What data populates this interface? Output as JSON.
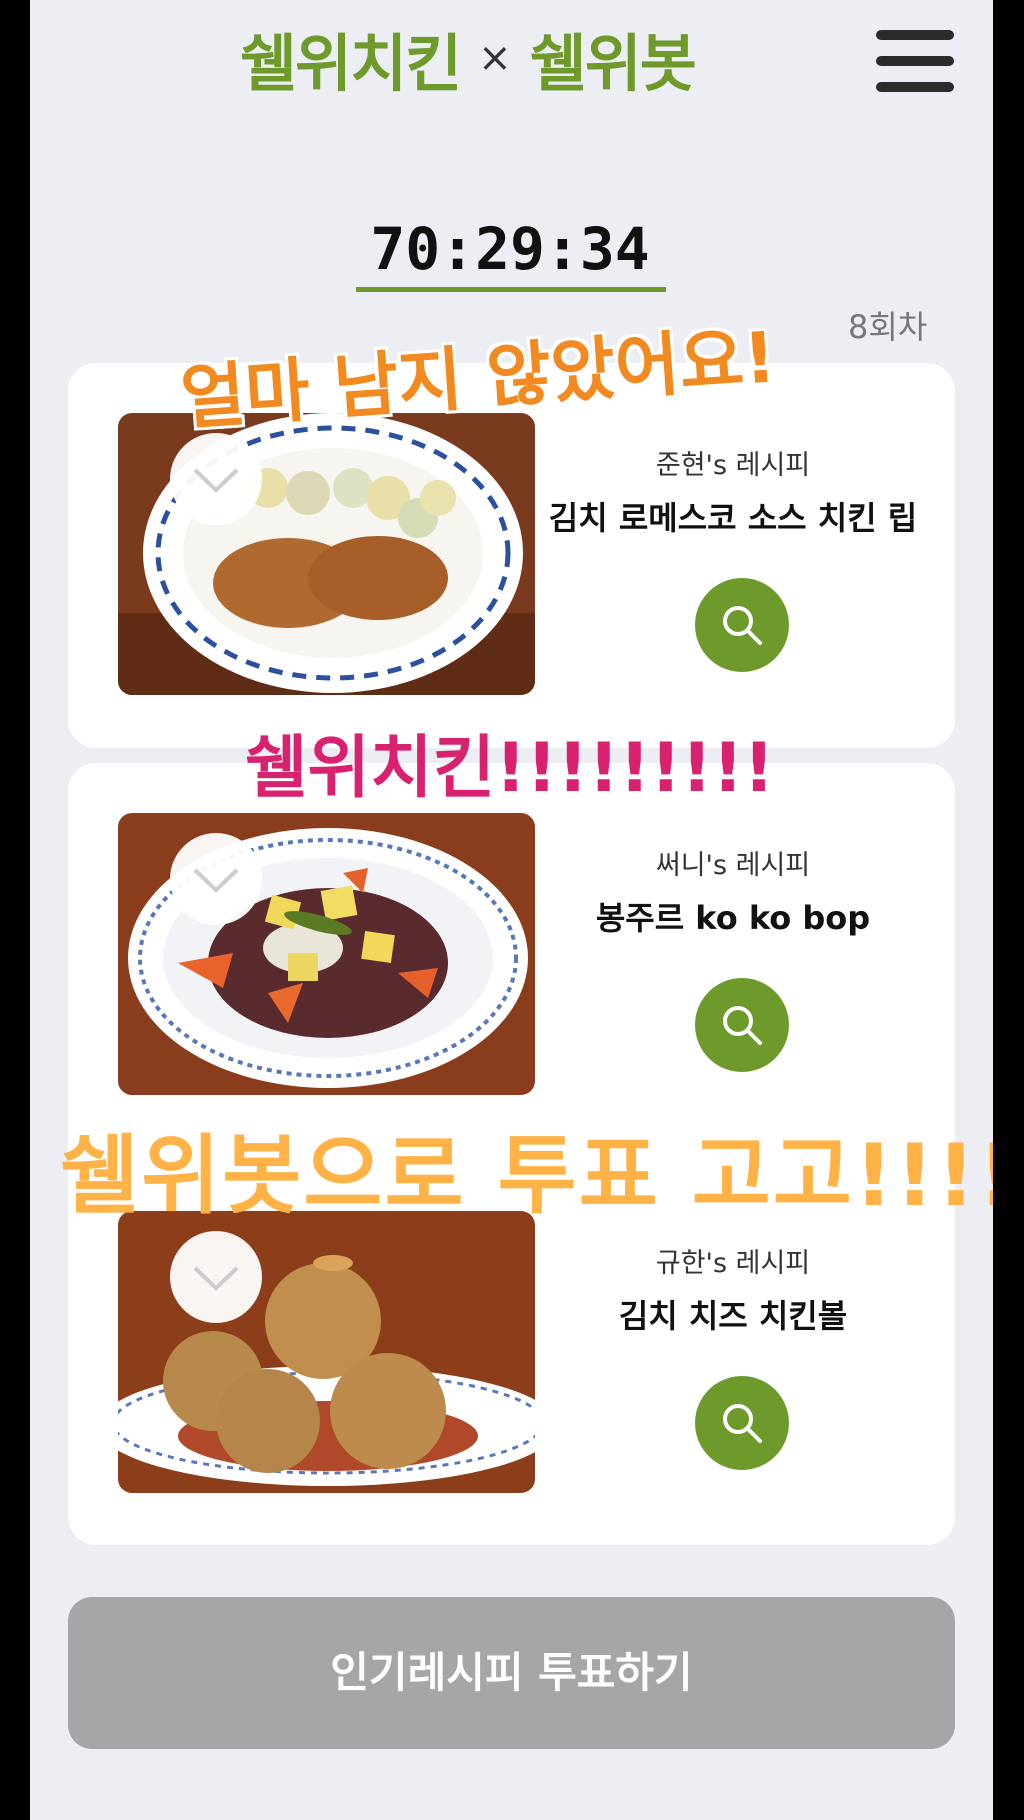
{
  "header": {
    "logo_left": "쉘위치킨",
    "logo_sep": "×",
    "logo_right": "쉘위봇"
  },
  "timer": {
    "value": "70:29:34"
  },
  "round": {
    "label": "8회차"
  },
  "recipes": [
    {
      "author": "준현's 레시피",
      "title": "김치 로메스코 소스 치킨 립"
    },
    {
      "author": "써니's 레시피",
      "title": "봉주르 ko ko bop"
    },
    {
      "author": "규한's 레시피",
      "title": "김치 치즈 치킨볼"
    }
  ],
  "vote_button": {
    "label": "인기레시피 투표하기"
  },
  "overlays": {
    "text_1": "얼마 남지 않았어요!",
    "text_2": "쉘위치킨!!!!!!!!!",
    "text_3": "쉘위봇으로 투표 고고!!!!"
  },
  "colors": {
    "accent": "#6e9a2c",
    "background": "#edeef3",
    "button_disabled": "#a6a6a6",
    "overlay_1": "#f28a22",
    "overlay_2": "#d9226f",
    "overlay_3": "#ffb347"
  },
  "icons": {
    "menu": "hamburger-icon",
    "select": "check-icon",
    "search": "search-icon"
  }
}
